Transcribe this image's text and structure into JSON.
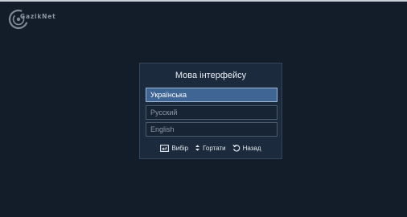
{
  "brand": {
    "name": "GazikNet"
  },
  "dialog": {
    "title": "Мова інтерфейсу",
    "options": [
      {
        "label": "Українська",
        "selected": true
      },
      {
        "label": "Русский",
        "selected": false
      },
      {
        "label": "English",
        "selected": false
      }
    ],
    "hints": [
      {
        "icon": "enter-icon",
        "label": "Вибір"
      },
      {
        "icon": "up-down-arrows-icon",
        "label": "Гортати"
      },
      {
        "icon": "back-arrow-icon",
        "label": "Назад"
      }
    ]
  },
  "colors": {
    "background": "#131d2a",
    "panel": "#1b2a3c",
    "selected": "#3f6595"
  }
}
